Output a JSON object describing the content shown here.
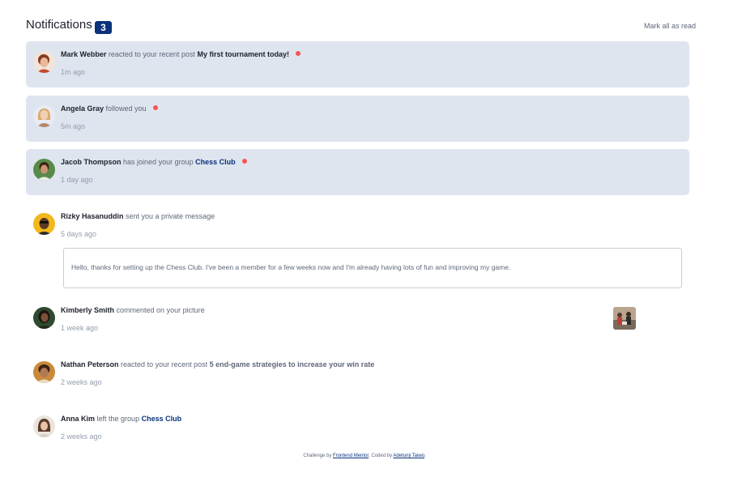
{
  "header": {
    "title": "Notifications",
    "count": "3",
    "mark_all": "Mark all as read"
  },
  "notifications": [
    {
      "name": "Mark Webber",
      "action": "reacted to your recent post",
      "target": "My first tournament today!",
      "time": "1m ago",
      "unread": true
    },
    {
      "name": "Angela Gray",
      "action": "followed you",
      "time": "5m ago",
      "unread": true
    },
    {
      "name": "Jacob Thompson",
      "action": "has joined your group",
      "target": "Chess Club",
      "time": "1 day ago",
      "unread": true
    },
    {
      "name": "Rizky Hasanuddin",
      "action": "sent you a private message",
      "time": "5 days ago",
      "unread": false,
      "message": "Hello, thanks for setting up the Chess Club. I've been a member for a few weeks now and I'm already having lots of fun and improving my game."
    },
    {
      "name": "Kimberly Smith",
      "action": "commented on your picture",
      "time": "1 week ago",
      "unread": false
    },
    {
      "name": "Nathan Peterson",
      "action": "reacted to your recent post",
      "target": "5 end-game strategies to increase your win rate",
      "time": "2 weeks ago",
      "unread": false
    },
    {
      "name": "Anna Kim",
      "action": "left the group",
      "target": "Chess Club",
      "time": "2 weeks ago",
      "unread": false
    }
  ],
  "footer": {
    "prefix": "Challenge by",
    "link1": "Frontend Mentor",
    "middle": ". Coded by",
    "link2": "Adetunji Taiwo",
    "suffix": "."
  },
  "colors": {
    "unread_bg": "#dee5ef",
    "badge": "#0a327b",
    "dot": "#f65552",
    "group_link": "#0a327b"
  },
  "icons": {
    "avatar": "avatar-photo",
    "unread": "unread-dot-icon",
    "picture": "picture-thumbnail"
  }
}
